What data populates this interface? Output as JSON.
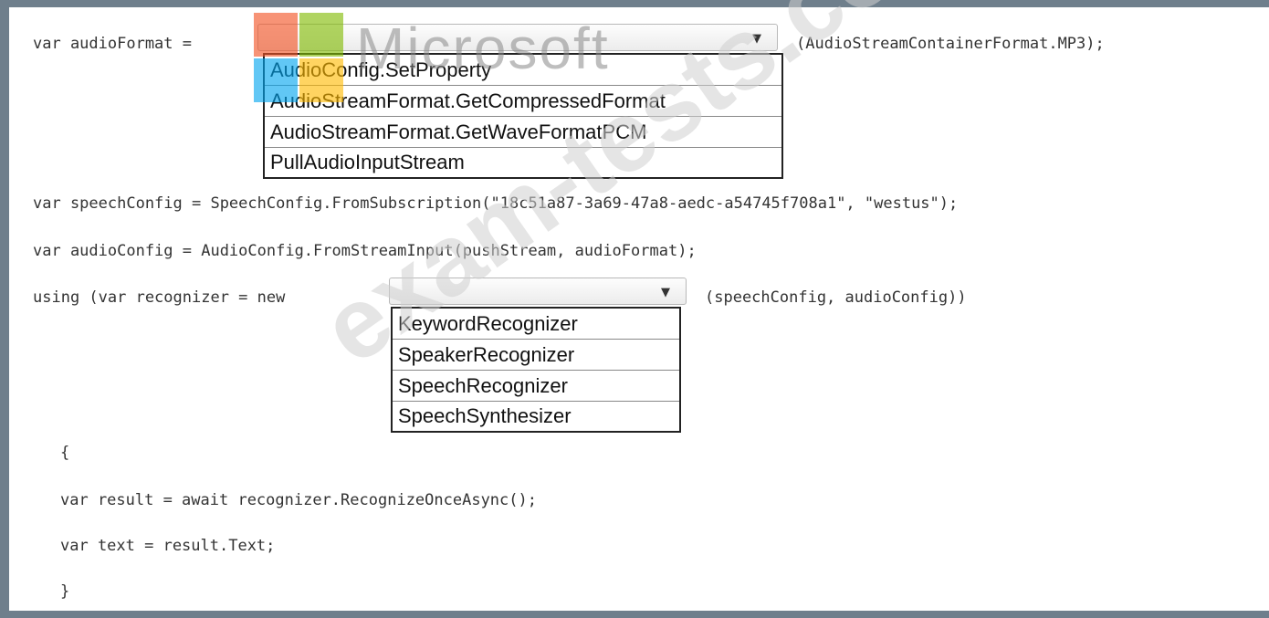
{
  "code": {
    "line1_prefix": "var audioFormat =",
    "line1_suffix": "(AudioStreamContainerFormat.MP3);",
    "line2": "var speechConfig = SpeechConfig.FromSubscription(\"18c51a87-3a69-47a8-aedc-a54745f708a1\", \"westus\");",
    "line3": "var audioConfig = AudioConfig.FromStreamInput(pushStream, audioFormat);",
    "line4_prefix": "using (var recognizer = new",
    "line4_suffix": "(speechConfig, audioConfig))",
    "brace_open": "{",
    "line5": "var result = await recognizer.RecognizeOnceAsync();",
    "line6": "var text = result.Text;",
    "brace_close": "}"
  },
  "dropdown1": {
    "selected": "",
    "arrow_icon": "▼",
    "options": [
      "AudioConfig.SetProperty",
      "AudioStreamFormat.GetCompressedFormat",
      "AudioStreamFormat.GetWaveFormatPCM",
      "PullAudioInputStream"
    ]
  },
  "dropdown2": {
    "selected": "",
    "arrow_icon": "▼",
    "options": [
      "KeywordRecognizer",
      "SpeakerRecognizer",
      "SpeechRecognizer",
      "SpeechSynthesizer"
    ]
  },
  "watermarks": {
    "logo_text": "Microsoft",
    "site_text": "exam-tests.com"
  },
  "colors": {
    "logo_red": "#f25022",
    "logo_green": "#7fba00",
    "logo_blue": "#00a4ef",
    "logo_yellow": "#ffb900"
  }
}
